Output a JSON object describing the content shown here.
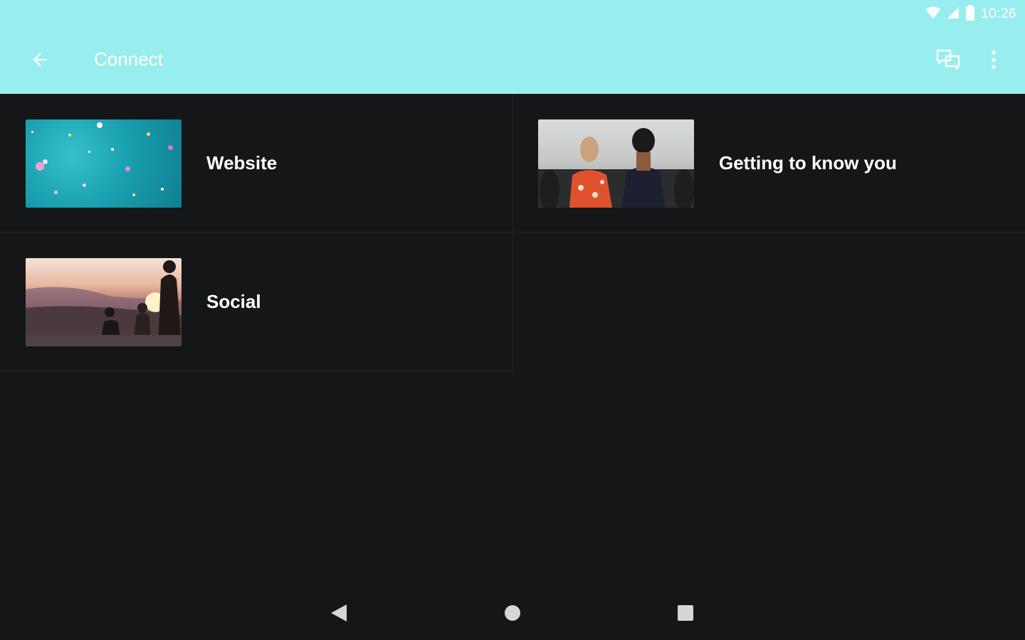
{
  "status_bar": {
    "time": "10:26",
    "icons": [
      "wifi-icon",
      "signal-icon",
      "battery-icon"
    ]
  },
  "app_bar": {
    "title": "Connect",
    "back_icon": "arrow-back-icon",
    "actions": [
      "chat-icon",
      "more-vert-icon"
    ]
  },
  "cards": [
    {
      "label": "Website",
      "thumbnail": "confetti-teal"
    },
    {
      "label": "Getting to know you",
      "thumbnail": "people-crowd"
    },
    {
      "label": "Social",
      "thumbnail": "sunset-hill"
    }
  ],
  "nav_bar": {
    "buttons": [
      "back-triangle-icon",
      "home-circle-icon",
      "recents-square-icon"
    ]
  },
  "colors": {
    "app_bar": "#98eeef",
    "background": "#151618",
    "text": "#ffffff",
    "divider": "#222426"
  }
}
